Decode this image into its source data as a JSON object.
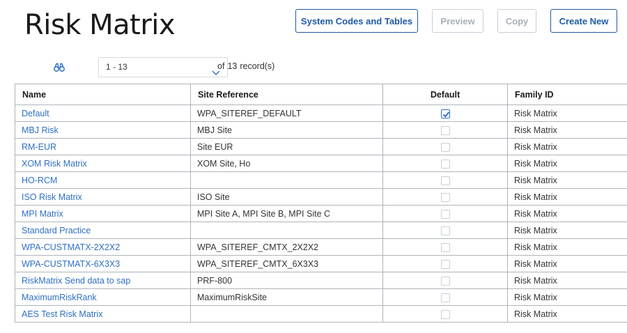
{
  "page": {
    "title": "Risk Matrix"
  },
  "toolbar": {
    "buttons": [
      {
        "label": "System Codes and Tables",
        "enabled": true
      },
      {
        "label": "Preview",
        "enabled": false
      },
      {
        "label": "Copy",
        "enabled": false
      },
      {
        "label": "Create New",
        "enabled": true
      }
    ]
  },
  "pager": {
    "search_icon": "binoculars-icon",
    "range": "1 - 13",
    "of_label": "of",
    "total": "13",
    "records_label": "record(s)"
  },
  "table": {
    "columns": [
      "Name",
      "Site Reference",
      "Default",
      "Family ID"
    ],
    "rows": [
      {
        "name": "Default",
        "site": "WPA_SITEREF_DEFAULT",
        "default": true,
        "family": "Risk Matrix"
      },
      {
        "name": "MBJ Risk",
        "site": "MBJ Site",
        "default": false,
        "family": "Risk Matrix"
      },
      {
        "name": "RM-EUR",
        "site": "Site EUR",
        "default": false,
        "family": "Risk Matrix"
      },
      {
        "name": "XOM Risk Matrix",
        "site": "XOM Site, Ho",
        "default": false,
        "family": "Risk Matrix"
      },
      {
        "name": "HO-RCM",
        "site": "",
        "default": false,
        "family": "Risk Matrix"
      },
      {
        "name": "ISO Risk Matrix",
        "site": "ISO Site",
        "default": false,
        "family": "Risk Matrix"
      },
      {
        "name": "MPI Matrix",
        "site": "MPI Site A, MPI Site B, MPI Site C",
        "default": false,
        "family": "Risk Matrix"
      },
      {
        "name": "Standard Practice",
        "site": "",
        "default": false,
        "family": "Risk Matrix"
      },
      {
        "name": "WPA-CUSTMATX-2X2X2",
        "site": "WPA_SITEREF_CMTX_2X2X2",
        "default": false,
        "family": "Risk Matrix"
      },
      {
        "name": "WPA-CUSTMATX-6X3X3",
        "site": "WPA_SITEREF_CMTX_6X3X3",
        "default": false,
        "family": "Risk Matrix"
      },
      {
        "name": "RiskMatrix Send data to sap",
        "site": "PRF-800",
        "default": false,
        "family": "Risk Matrix"
      },
      {
        "name": "MaximumRiskRank",
        "site": "MaximumRiskSite",
        "default": false,
        "family": "Risk Matrix"
      },
      {
        "name": "AES Test Risk Matrix",
        "site": "",
        "default": false,
        "family": "Risk Matrix"
      }
    ]
  },
  "colors": {
    "link": "#2f6fc0",
    "button": "#1f5aa6",
    "disabled": "#a9b0b8"
  }
}
